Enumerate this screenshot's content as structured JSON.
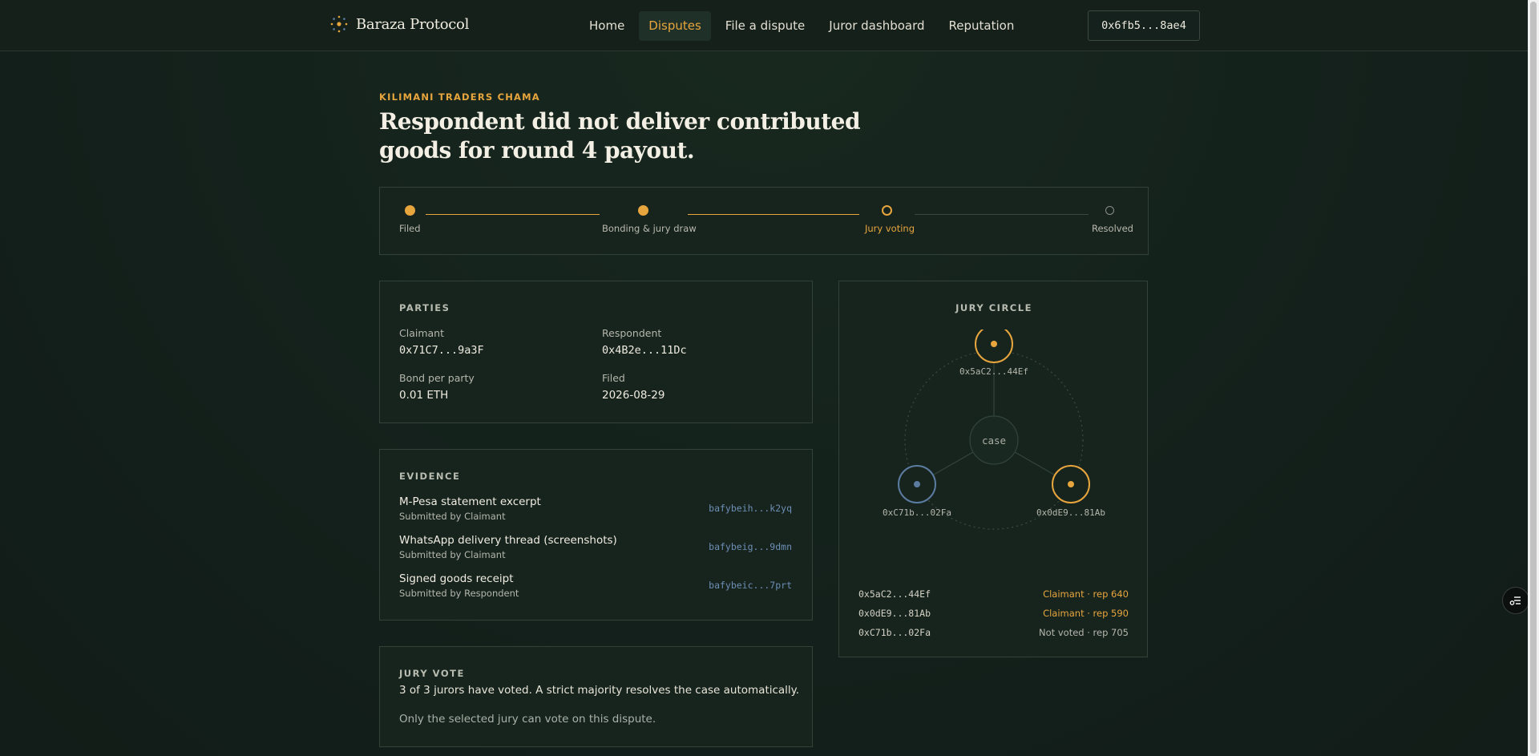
{
  "header": {
    "brand_name": "Baraza Protocol",
    "nav": [
      {
        "label": "Home",
        "active": false
      },
      {
        "label": "Disputes",
        "active": true
      },
      {
        "label": "File a dispute",
        "active": false
      },
      {
        "label": "Juror dashboard",
        "active": false
      },
      {
        "label": "Reputation",
        "active": false
      }
    ],
    "wallet": "0x6fb5...8ae4"
  },
  "dispute": {
    "group": "KILIMANI TRADERS CHAMA",
    "title": "Respondent did not deliver contributed goods for round 4 payout."
  },
  "stepper": {
    "steps": [
      {
        "label": "Filed",
        "state": "done"
      },
      {
        "label": "Bonding & jury draw",
        "state": "done"
      },
      {
        "label": "Jury voting",
        "state": "current"
      },
      {
        "label": "Resolved",
        "state": "pending"
      }
    ]
  },
  "parties": {
    "heading": "PARTIES",
    "claimant_label": "Claimant",
    "claimant": "0x71C7...9a3F",
    "respondent_label": "Respondent",
    "respondent": "0x4B2e...11Dc",
    "bond_label": "Bond per party",
    "bond": "0.01 ETH",
    "filed_label": "Filed",
    "filed": "2026-08-29"
  },
  "evidence": {
    "heading": "EVIDENCE",
    "items": [
      {
        "title": "M-Pesa statement excerpt",
        "submitted_by": "Submitted by Claimant",
        "cid": "bafybeih...k2yq"
      },
      {
        "title": "WhatsApp delivery thread (screenshots)",
        "submitted_by": "Submitted by Claimant",
        "cid": "bafybeig...9dmn"
      },
      {
        "title": "Signed goods receipt",
        "submitted_by": "Submitted by Respondent",
        "cid": "bafybeic...7prt"
      }
    ]
  },
  "vote": {
    "heading": "JURY VOTE",
    "summary": "3 of 3 jurors have voted. A strict majority resolves the case automatically.",
    "note": "Only the selected jury can vote on this dispute."
  },
  "jury": {
    "heading": "JURY CIRCLE",
    "center_label": "case",
    "nodes": [
      {
        "addr": "0x5aC2...44Ef",
        "status": "claimant"
      },
      {
        "addr": "0xC71b...02Fa",
        "status": "not-voted"
      },
      {
        "addr": "0x0dE9...81Ab",
        "status": "claimant"
      }
    ],
    "rows": [
      {
        "addr": "0x5aC2...44Ef",
        "status": "Claimant · rep 640",
        "color": "#e7a53d"
      },
      {
        "addr": "0x0dE9...81Ab",
        "status": "Claimant · rep 590",
        "color": "#e7a53d"
      },
      {
        "addr": "0xC71b...02Fa",
        "status": "Not voted · rep 705",
        "color": "#b5b6ac"
      }
    ]
  },
  "colors": {
    "accent": "#e7a53d",
    "blue": "#5b7ca0",
    "background": "#13201b",
    "panel": "#17241e"
  }
}
